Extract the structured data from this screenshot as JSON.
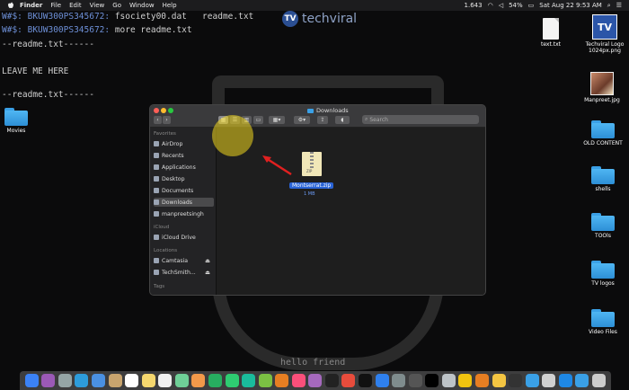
{
  "menubar": {
    "items": [
      "Finder",
      "File",
      "Edit",
      "View",
      "Go",
      "Window",
      "Help"
    ],
    "net_speed": "1.643",
    "battery": "54%",
    "datetime": "Sat Aug 22  9:53 AM"
  },
  "terminal": {
    "lines": [
      {
        "prefix": "W#$: BKUW300PS345672:",
        "text": " fsociety00.dat   readme.txt"
      },
      {
        "prefix": "W#$: BKUW300PS345672:",
        "text": " more readme.txt"
      },
      {
        "prefix": "",
        "text": "--readme.txt------"
      },
      {
        "prefix": "",
        "text": "LEAVE ME HERE"
      },
      {
        "prefix": "",
        "text": "--readme.txt------"
      }
    ],
    "bottom_text": "hello friend"
  },
  "watermark": "techviral",
  "desktop": {
    "left": [
      {
        "label": "Movies",
        "icon": "folder"
      }
    ],
    "right": [
      {
        "label": "text.txt",
        "icon": "document"
      },
      {
        "label": "Techviral Logo 1024px.png",
        "icon": "image"
      },
      {
        "label": "Manpreet.jpg",
        "icon": "photo"
      },
      {
        "label": "OLD CONTENT",
        "icon": "folder"
      },
      {
        "label": "shells",
        "icon": "folder"
      },
      {
        "label": "TOOls",
        "icon": "folder"
      },
      {
        "label": "TV logos",
        "icon": "folder"
      },
      {
        "label": "Video Files",
        "icon": "folder"
      }
    ]
  },
  "finder": {
    "title": "Downloads",
    "search_placeholder": "Search",
    "sections": {
      "favorites": "Favorites",
      "icloud": "iCloud",
      "locations": "Locations",
      "tags": "Tags"
    },
    "favorites": [
      "AirDrop",
      "Recents",
      "Applications",
      "Desktop",
      "Documents",
      "Downloads",
      "manpreetsingh"
    ],
    "selected": "Downloads",
    "icloud": [
      "iCloud Drive"
    ],
    "locations": [
      "Camtasia",
      "TechSmith..."
    ],
    "file": {
      "name": "Montserrat.zip",
      "size": "1 MB",
      "icon_label": "ZIP"
    }
  },
  "colors": {
    "accent": "#2963d6",
    "folder": "#3aa0e6",
    "highlight": "#f0d71e",
    "arrow": "#e02020"
  },
  "dock": {
    "icons": [
      "finder",
      "siri",
      "launchpad",
      "safari",
      "mail",
      "contacts",
      "calendar",
      "notes",
      "reminders",
      "maps",
      "photos",
      "messages",
      "facetime",
      "camtasia",
      "bluestacks",
      "vlc",
      "itunes",
      "podcasts",
      "apple-tv",
      "news",
      "stocks",
      "app-store",
      "preferences",
      "calculator",
      "terminal",
      "preview",
      "chrome-canary",
      "firefox",
      "chrome",
      "activity-monitor",
      "downloads-folder",
      "image-capture",
      "edge",
      "documents",
      "trash"
    ]
  }
}
